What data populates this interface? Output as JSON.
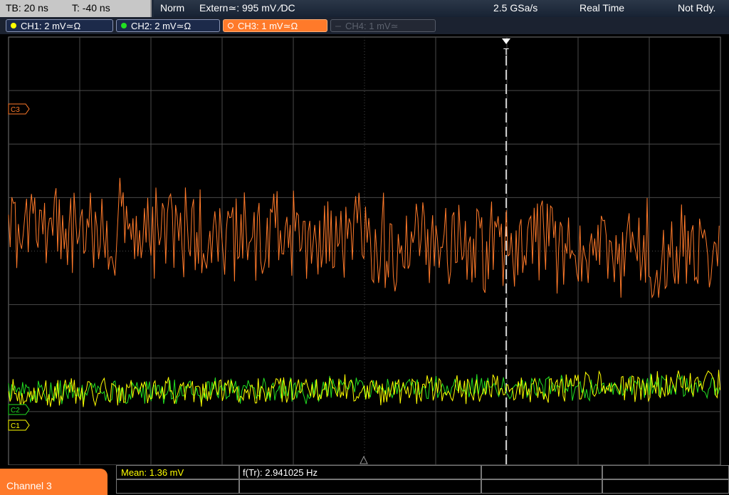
{
  "topbar": {
    "timebase": "TB: 20 ns",
    "trigger_time": "T: -40 ns",
    "mode": "Norm",
    "trigger_source": "Extern≃: 995 mV ⁄DC",
    "sample_rate": "2.5 GSa/s",
    "acq_mode": "Real Time",
    "status": "Not Rdy."
  },
  "channels": [
    {
      "label": "CH1: 2 mV≃Ω",
      "color": "#ffff00",
      "state": "on"
    },
    {
      "label": "CH2: 2 mV≃Ω",
      "color": "#22e022",
      "state": "on"
    },
    {
      "label": "CH3: 1 mV≃Ω",
      "color": "#ff7a2a",
      "state": "selected"
    },
    {
      "label": "CH4: 1 mV≃",
      "color": "#5c626e",
      "state": "off"
    }
  ],
  "markers": {
    "c3": "C3",
    "c2": "C2",
    "c1": "C1",
    "trigger": "T"
  },
  "bottombar": {
    "active_channel": "Channel 3",
    "measurements": [
      {
        "label": "Mean: 1.36 mV",
        "color": "#ffff00"
      },
      {
        "label": "f(Tr): 2.941025 Hz",
        "color": "#ffffff"
      }
    ]
  },
  "colors": {
    "grid": "#4a4a4a",
    "ch1": "#ffff00",
    "ch2": "#22e022",
    "ch3": "#ff7a2a",
    "trigger_line": "#ffffff"
  }
}
